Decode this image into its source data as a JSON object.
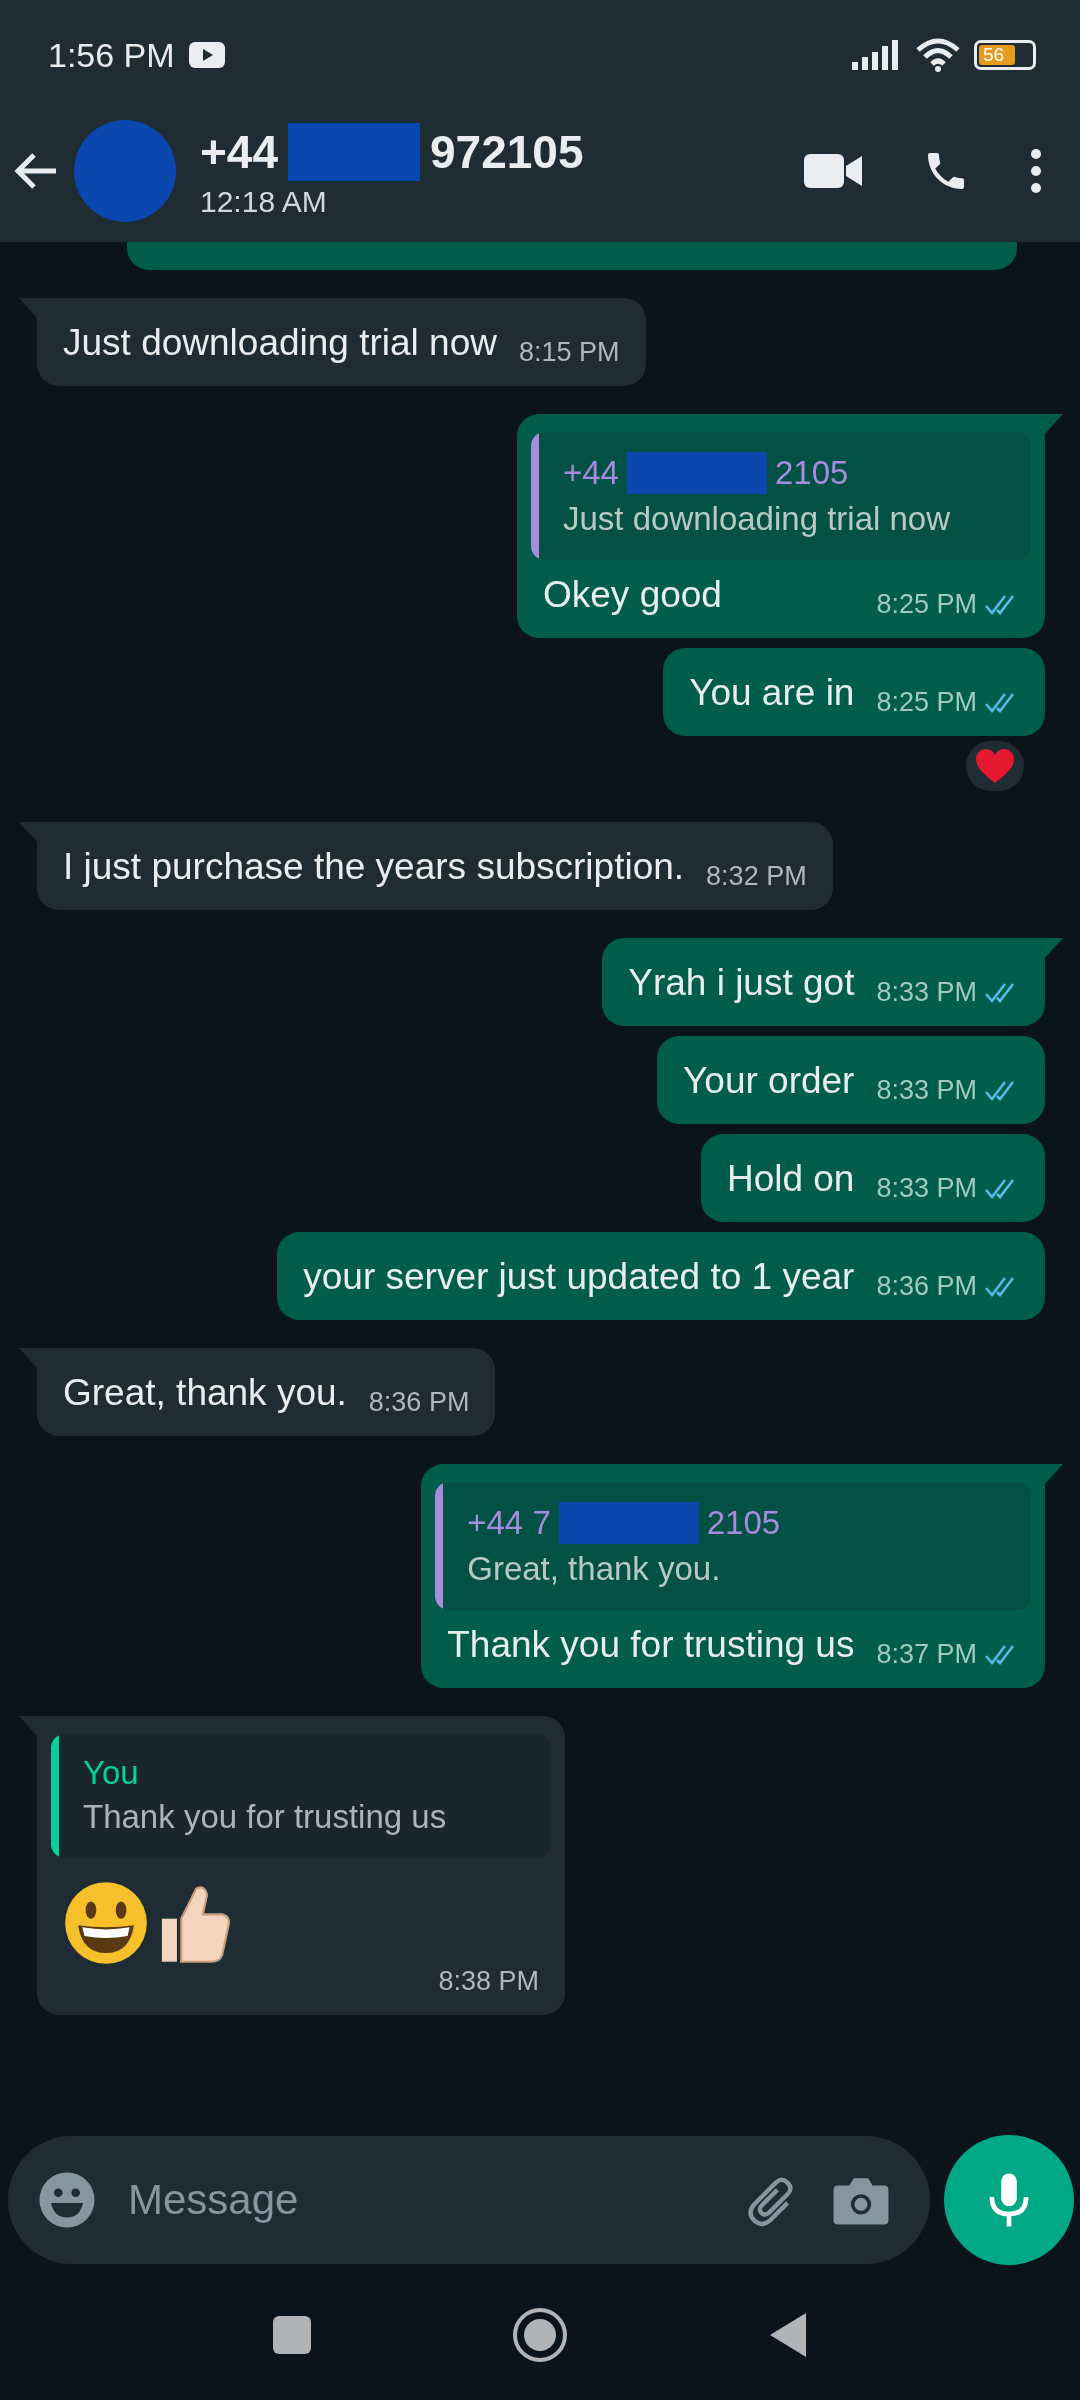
{
  "status_bar": {
    "time": "1:56 PM",
    "battery": "56"
  },
  "header": {
    "name_start": "+44",
    "name_end": "972105",
    "subtitle": "12:18 AM"
  },
  "messages": [
    {
      "kind": "partial"
    },
    {
      "kind": "received",
      "tail": true,
      "text": "Just downloading trial now",
      "time": "8:15 PM"
    },
    {
      "kind": "sent",
      "tail": true,
      "quote": {
        "author_start": "+44",
        "author_end": "2105",
        "text": "Just downloading trial now",
        "color": "#a78bde"
      },
      "text": "Okey good",
      "time": "8:25 PM",
      "read": true
    },
    {
      "kind": "sent",
      "tail": false,
      "text": "You are in",
      "time": "8:25 PM",
      "read": true,
      "reaction": {
        "kind": "heart"
      }
    },
    {
      "kind": "received",
      "tail": true,
      "text": "I just purchase the years subscription.",
      "time": "8:32 PM"
    },
    {
      "kind": "sent",
      "tail": true,
      "text": "Yrah i just got",
      "time": "8:33 PM",
      "read": true
    },
    {
      "kind": "sent",
      "tail": false,
      "text": "Your order",
      "time": "8:33 PM",
      "read": true
    },
    {
      "kind": "sent",
      "tail": false,
      "text": "Hold on",
      "time": "8:33 PM",
      "read": true
    },
    {
      "kind": "sent",
      "tail": false,
      "text": "your server just updated to 1 year",
      "time": "8:36 PM",
      "read": true
    },
    {
      "kind": "received",
      "tail": true,
      "text": "Great, thank you.",
      "time": "8:36 PM"
    },
    {
      "kind": "sent",
      "tail": true,
      "quote": {
        "author_start": "+44 7",
        "author_end": "2105",
        "text": "Great, thank you.",
        "color": "#a78bde"
      },
      "text": "Thank you for trusting us",
      "time": "8:37 PM",
      "read": true
    },
    {
      "kind": "received",
      "tail": true,
      "quote": {
        "author_start": "You",
        "text": "Thank you for trusting us",
        "color": "#06cf9c"
      },
      "emojis": [
        {
          "kind": "grin"
        },
        {
          "kind": "thumbs-up"
        }
      ],
      "time": "8:38 PM"
    }
  ],
  "composer": {
    "placeholder": "Message"
  }
}
